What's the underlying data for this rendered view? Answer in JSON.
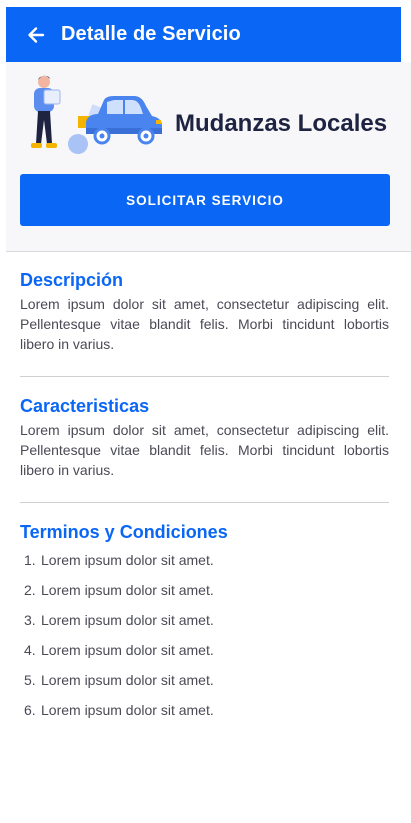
{
  "header": {
    "title": "Detalle de Servicio",
    "back_icon": "arrow-left-icon"
  },
  "service": {
    "name": "Mudanzas Locales",
    "illustration": "moving-truck-illustration",
    "cta_label": "SOLICITAR SERVICIO"
  },
  "sections": {
    "description": {
      "title": "Descripción",
      "text": "Lorem ipsum dolor sit amet, consectetur adipiscing elit. Pellentesque vitae blandit felis. Morbi tincidunt lobortis libero in varius."
    },
    "features": {
      "title": "Caracteristicas",
      "text": "Lorem ipsum dolor sit amet, consectetur adipiscing elit. Pellentesque vitae blandit felis. Morbi tincidunt lobortis libero in varius."
    },
    "terms": {
      "title": "Terminos y Condiciones",
      "items": [
        {
          "num": "1.",
          "text": "Lorem ipsum dolor sit amet."
        },
        {
          "num": "2.",
          "text": "Lorem ipsum dolor sit amet."
        },
        {
          "num": "3.",
          "text": "Lorem ipsum dolor sit amet."
        },
        {
          "num": "4.",
          "text": "Lorem ipsum dolor sit amet."
        },
        {
          "num": "5.",
          "text": "Lorem ipsum dolor sit amet."
        },
        {
          "num": "6.",
          "text": "Lorem ipsum dolor sit amet."
        }
      ]
    }
  },
  "colors": {
    "primary": "#0a66f5",
    "heading": "#1d2340",
    "text": "#4a4a55"
  }
}
